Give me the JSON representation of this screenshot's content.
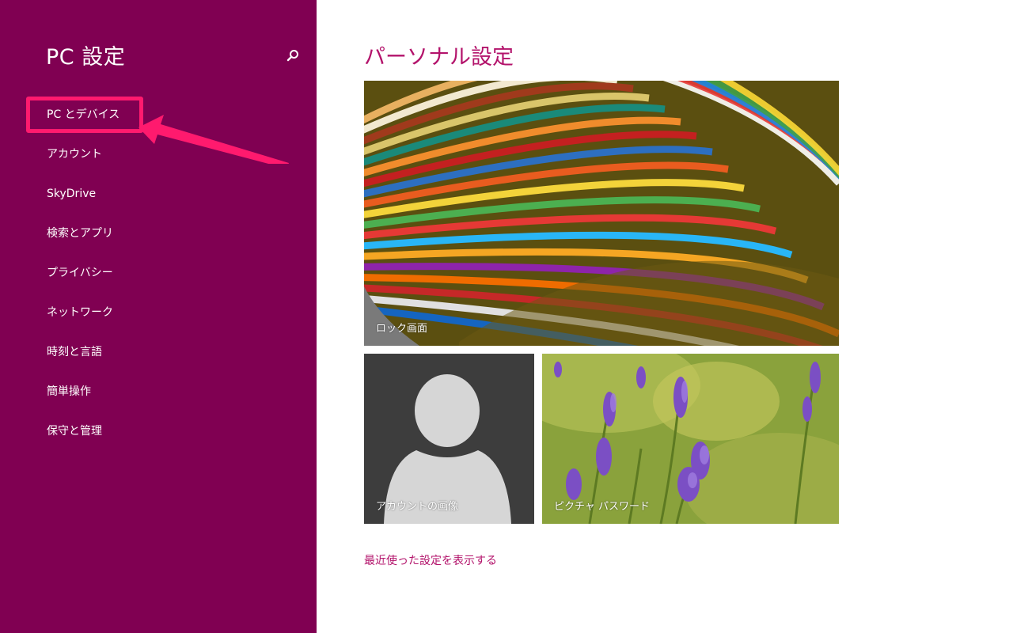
{
  "sidebar": {
    "title": "PC 設定",
    "search_icon": "search-icon",
    "items": [
      {
        "label": "PC とデバイス"
      },
      {
        "label": "アカウント"
      },
      {
        "label": "SkyDrive"
      },
      {
        "label": "検索とアプリ"
      },
      {
        "label": "プライバシー"
      },
      {
        "label": "ネットワーク"
      },
      {
        "label": "時刻と言語"
      },
      {
        "label": "簡単操作"
      },
      {
        "label": "保守と管理"
      }
    ]
  },
  "main": {
    "title": "パーソナル設定",
    "tiles": {
      "lock_screen": "ロック画面",
      "account_picture": "アカウントの画像",
      "picture_password": "ピクチャ パスワード"
    },
    "recent_link": "最近使った設定を表示する"
  },
  "colors": {
    "sidebar_bg": "#800052",
    "accent": "#b3136b",
    "highlight": "#ff1a6e"
  }
}
